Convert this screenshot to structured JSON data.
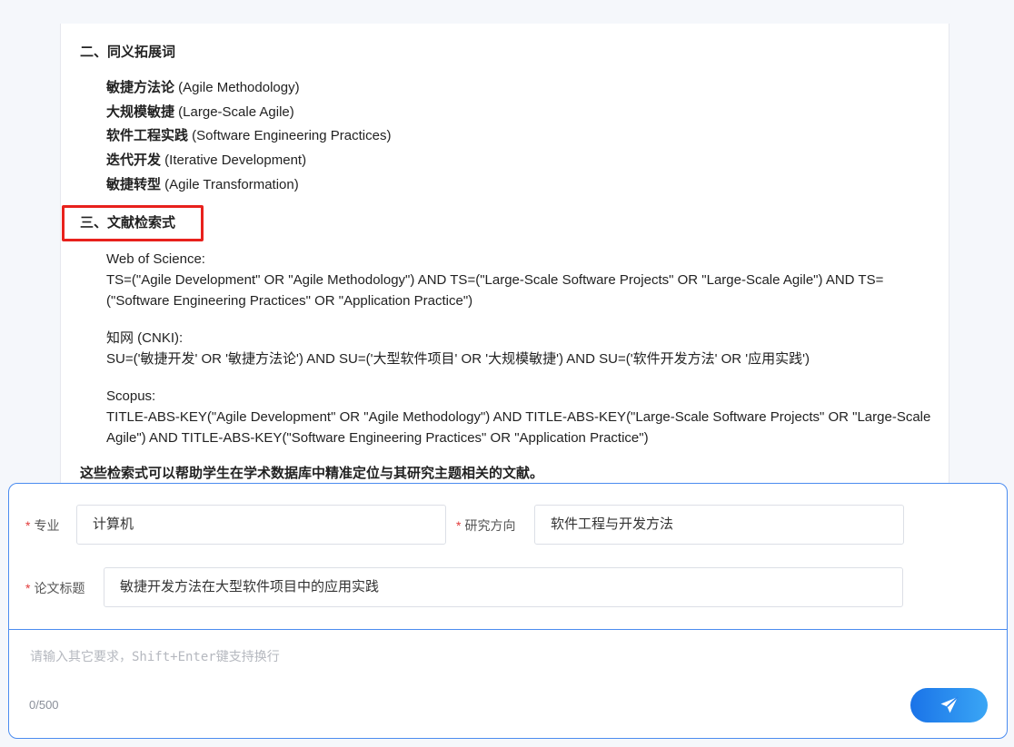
{
  "doc": {
    "section2_title": "二、同义拓展词",
    "synonyms": [
      {
        "cn": "敏捷方法论",
        "en": " (Agile Methodology)"
      },
      {
        "cn": "大规模敏捷",
        "en": " (Large-Scale Agile)"
      },
      {
        "cn": "软件工程实践",
        "en": " (Software Engineering Practices)"
      },
      {
        "cn": "迭代开发",
        "en": " (Iterative Development)"
      },
      {
        "cn": "敏捷转型",
        "en": " (Agile Transformation)"
      }
    ],
    "section3_title": "三、文献检索式",
    "wos": {
      "name": "Web of Science:",
      "query": "TS=(\"Agile Development\" OR \"Agile Methodology\") AND TS=(\"Large-Scale Software Projects\" OR \"Large-Scale Agile\") AND TS=(\"Software Engineering Practices\" OR \"Application Practice\")"
    },
    "cnki": {
      "name": "知网 (CNKI):",
      "query": "SU=('敏捷开发' OR '敏捷方法论') AND SU=('大型软件项目' OR '大规模敏捷') AND SU=('软件开发方法' OR '应用实践')"
    },
    "scopus": {
      "name": "Scopus:",
      "query": "TITLE-ABS-KEY(\"Agile Development\" OR \"Agile Methodology\") AND TITLE-ABS-KEY(\"Large-Scale Software Projects\" OR \"Large-Scale Agile\") AND TITLE-ABS-KEY(\"Software Engineering Practices\" OR \"Application Practice\")"
    },
    "summary": "这些检索式可以帮助学生在学术数据库中精准定位与其研究主题相关的文献。"
  },
  "form": {
    "required_mark": "*",
    "major_label": "专业",
    "major_value": "计算机",
    "direction_label": "研究方向",
    "direction_value": "软件工程与开发方法",
    "title_label": "论文标题",
    "title_value": "敏捷开发方法在大型软件项目中的应用实践",
    "textarea_placeholder": "请输入其它要求，Shift+Enter键支持换行",
    "counter": "0/500",
    "send_icon": "paper-plane-icon"
  },
  "colors": {
    "accent": "#1a73e8",
    "highlight_box": "#e8211c",
    "required": "#e23b3b"
  }
}
